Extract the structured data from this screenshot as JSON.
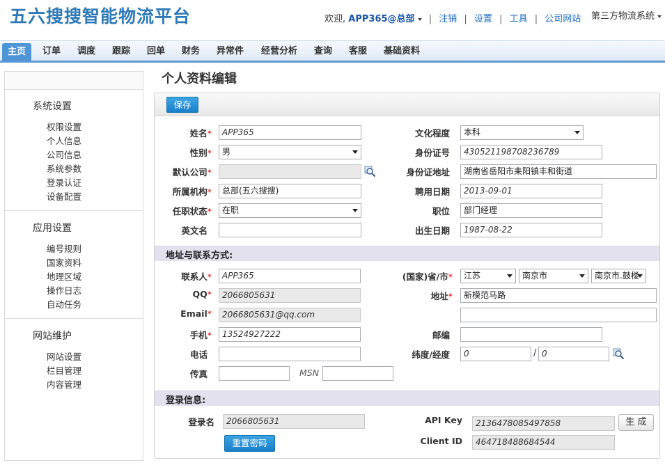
{
  "header": {
    "logo": "五六搜搜智能物流平台",
    "welcome": "欢迎,",
    "user": "APP365@总部",
    "links": [
      "注销",
      "设置",
      "工具",
      "公司网站"
    ],
    "system_switch": "第三方物流系统"
  },
  "nav": [
    "主页",
    "订单",
    "调度",
    "跟踪",
    "回单",
    "财务",
    "异常件",
    "经营分析",
    "查询",
    "客服",
    "基础资料"
  ],
  "sidebar": {
    "groups": [
      {
        "title": "系统设置",
        "items": [
          "权限设置",
          "个人信息",
          "公司信息",
          "系统参数",
          "登录认证",
          "设备配置"
        ]
      },
      {
        "title": "应用设置",
        "items": [
          "编号规则",
          "国家资料",
          "地理区域",
          "操作日志",
          "自动任务"
        ]
      },
      {
        "title": "网站维护",
        "items": [
          "网站设置",
          "栏目管理",
          "内容管理"
        ]
      }
    ]
  },
  "page": {
    "title": "个人资料编辑",
    "save_label": "保存"
  },
  "profile": {
    "name_label": "姓名",
    "name_value": "APP365",
    "gender_label": "性别",
    "gender_value": "男",
    "default_company_label": "默认公司",
    "default_company_value": "",
    "org_label": "所属机构",
    "org_value": "总部(五六搜搜)",
    "status_label": "任职状态",
    "status_value": "在职",
    "english_name_label": "英文名",
    "english_name_value": "",
    "education_label": "文化程度",
    "education_value": "本科",
    "id_number_label": "身份证号",
    "id_number_value": "430521198708236789",
    "id_address_label": "身份证地址",
    "id_address_value": "湖南省岳阳市耒阳镇丰和街道",
    "hire_date_label": "聘用日期",
    "hire_date_value": "2013-09-01",
    "position_label": "职位",
    "position_value": "部门经理",
    "birth_date_label": "出生日期",
    "birth_date_value": "1987-08-22"
  },
  "contact": {
    "section_title": "地址与联系方式:",
    "contact_person_label": "联系人",
    "contact_person_value": "APP365",
    "qq_label": "QQ",
    "qq_value": "2066805631",
    "email_label": "Email",
    "email_value": "2066805631@qq.com",
    "mobile_label": "手机",
    "mobile_value": "13524927222",
    "phone_label": "电话",
    "phone_value": "",
    "fax_label": "传真",
    "fax_value": "",
    "msn_label": "MSN",
    "msn_value": "",
    "region_label": "(国家)省/市",
    "province_value": "江苏",
    "city_value": "南京市",
    "district_value": "南京市.鼓楼",
    "address_label": "地址",
    "address_value": "新模范马路",
    "address_line2_value": "",
    "postcode_label": "邮编",
    "postcode_value": "",
    "latlng_label": "纬度/经度",
    "lat_value": "0",
    "lng_value": "0",
    "latlng_sep": "/"
  },
  "login": {
    "section_title": "登录信息:",
    "login_name_label": "登录名",
    "login_name_value": "2066805631",
    "reset_password_label": "重置密码",
    "api_key_label": "API Key",
    "api_key_value": "2136478085497858",
    "generate_label": "生 成",
    "client_id_label": "Client ID",
    "client_id_value": "464718488684544"
  },
  "colors": {
    "brand": "#2e79b8",
    "nav_active": "#4f95d6",
    "section_bg": "#e4e1ef",
    "button_blue": "#1a7fc8",
    "required": "#dd0000"
  }
}
